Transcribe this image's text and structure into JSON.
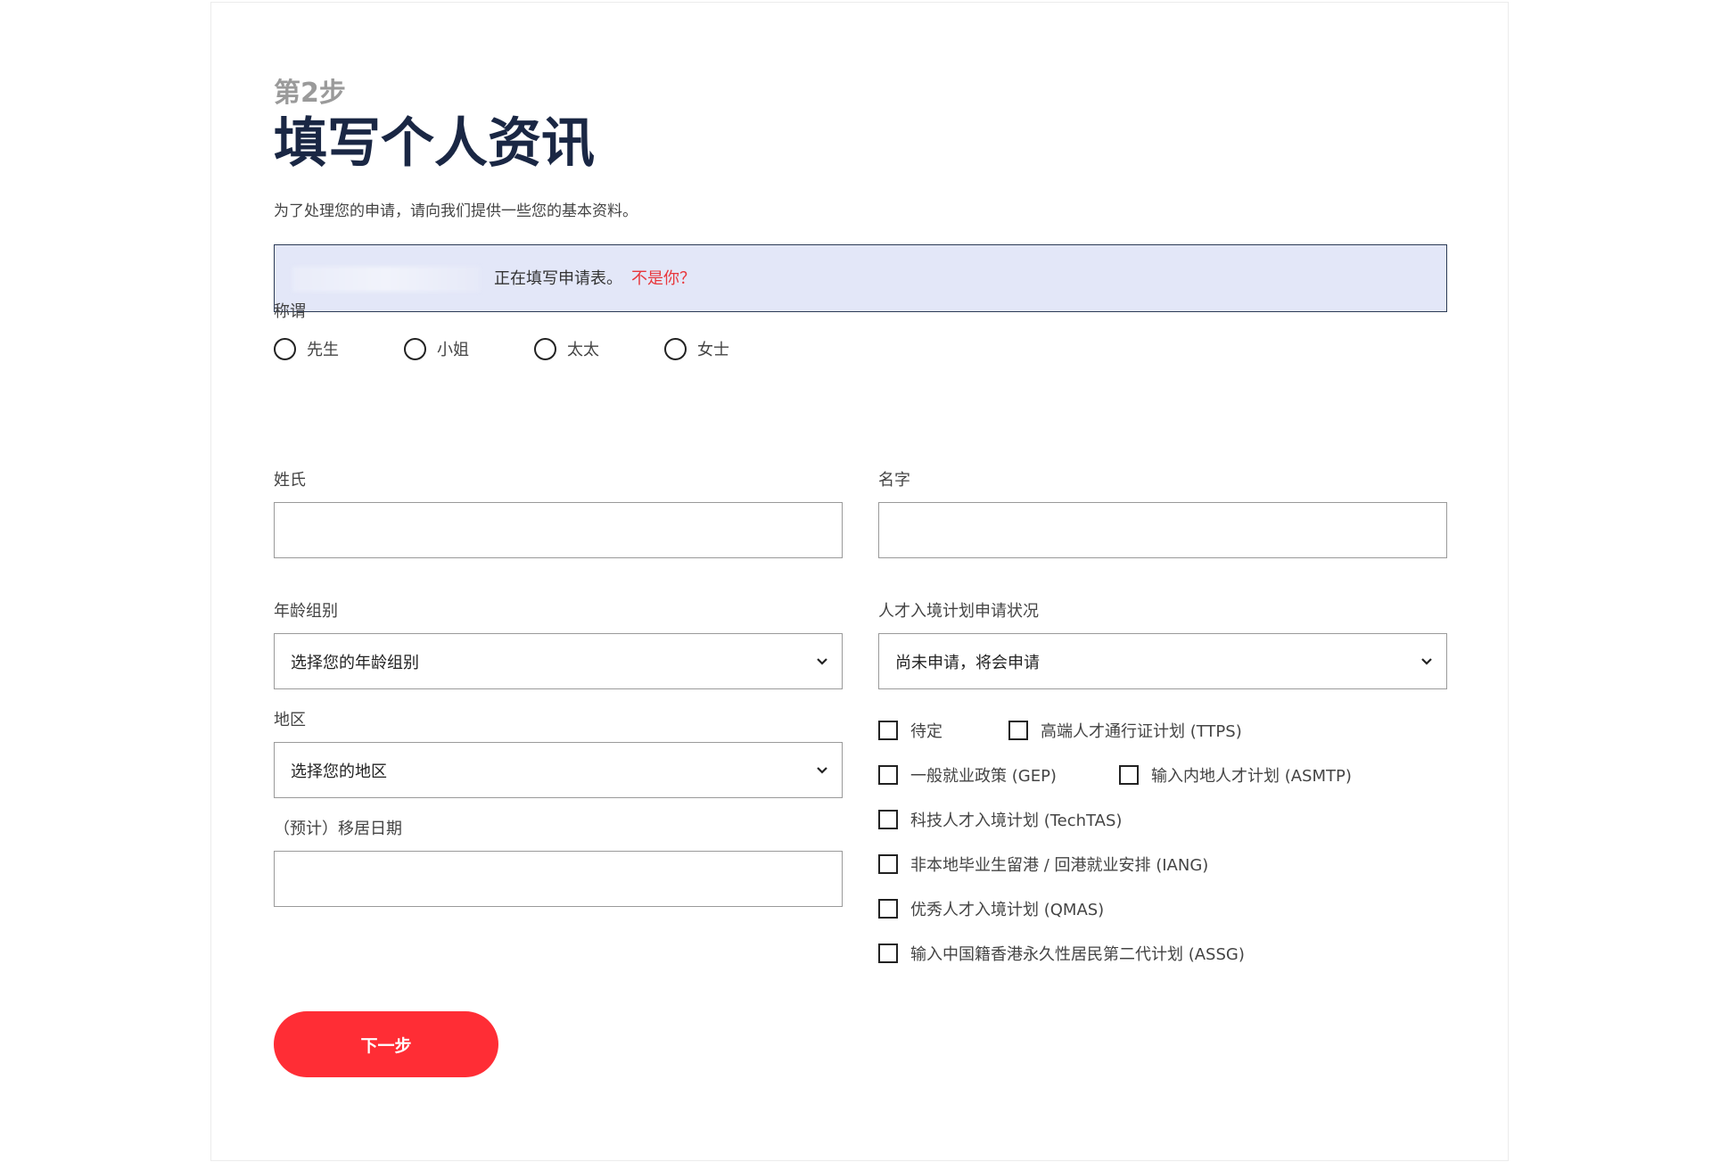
{
  "header": {
    "step": "第2步",
    "title": "填写个人资讯",
    "subtitle": "为了处理您的申请，请向我们提供一些您的基本资料。"
  },
  "notice": {
    "text": "正在填写申请表。",
    "link": "不是你？"
  },
  "salutation": {
    "label": "称谓",
    "options": [
      "先生",
      "小姐",
      "太太",
      "女士"
    ]
  },
  "fields": {
    "surname_label": "姓氏",
    "given_name_label": "名字",
    "age_group_label": "年龄组别",
    "age_group_value": "选择您的年龄组别",
    "talent_status_label": "人才入境计划申请状况",
    "talent_status_value": "尚未申请，将会申请",
    "region_label": "地区",
    "region_value": "选择您的地区",
    "move_date_label": "（预计）移居日期"
  },
  "schemes": [
    [
      "待定",
      "高端人才通行证计划 (TTPS)"
    ],
    [
      "一般就业政策 (GEP)",
      "输入内地人才计划 (ASMTP)"
    ],
    [
      "科技人才入境计划 (TechTAS)"
    ],
    [
      "非本地毕业生留港 / 回港就业安排 (IANG)"
    ],
    [
      "优秀人才入境计划 (QMAS)"
    ],
    [
      "输入中国籍香港永久性居民第二代计划 (ASSG)"
    ]
  ],
  "actions": {
    "next_label": "下一步"
  },
  "colors": {
    "primary_red": "#ff2d35",
    "title_navy": "#1a2744",
    "notice_bg": "#e3e7f8"
  }
}
